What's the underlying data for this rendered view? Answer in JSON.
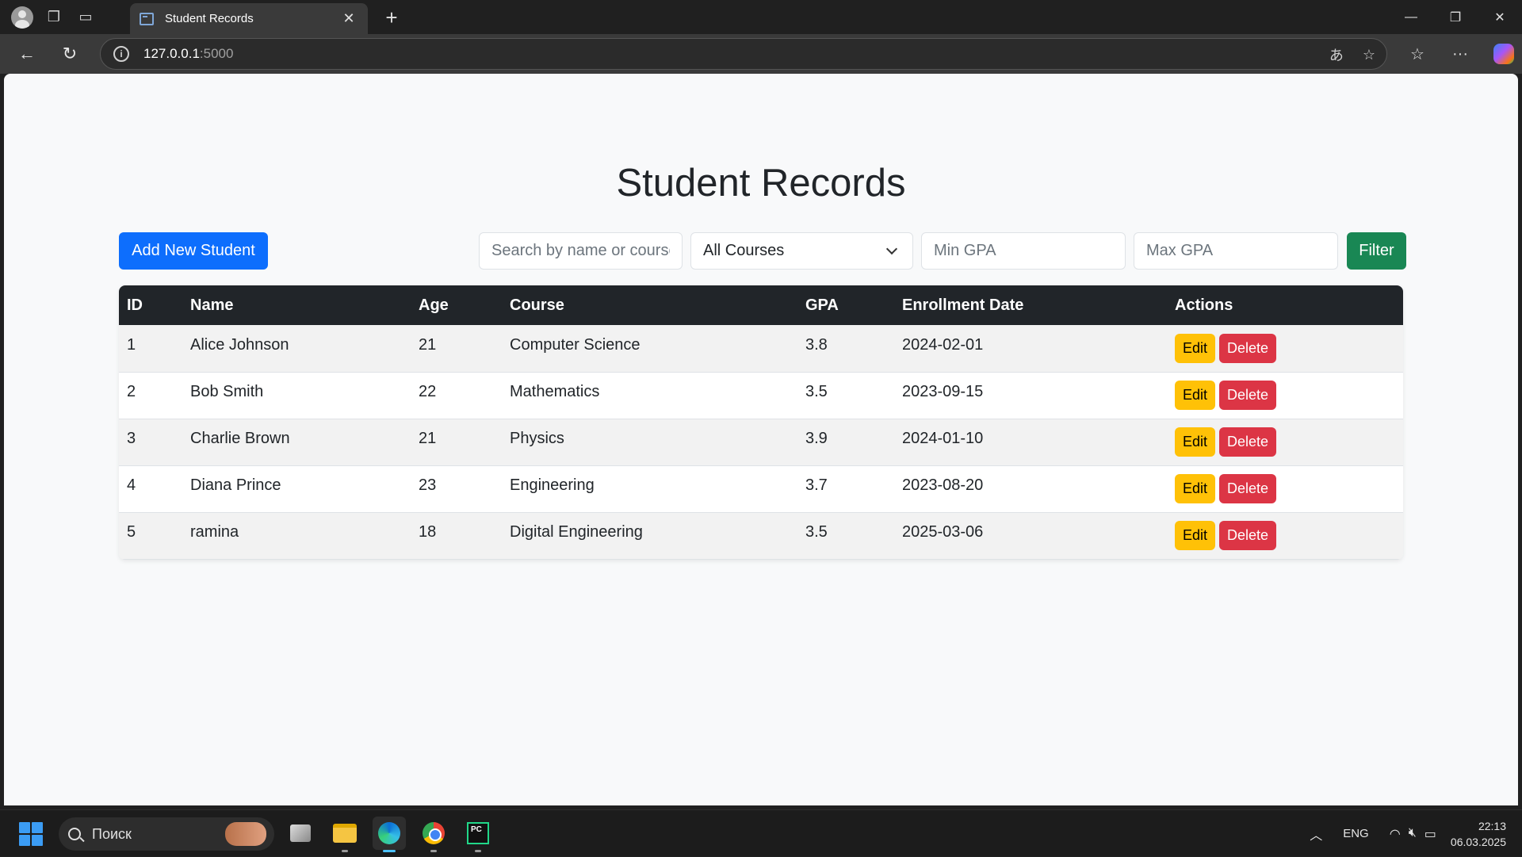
{
  "browser": {
    "tab_title": "Student Records",
    "url_host": "127.0.0.1",
    "url_port": ":5000",
    "close_tab_glyph": "✕",
    "new_tab_glyph": "+"
  },
  "page": {
    "title": "Student Records",
    "add_button": "Add New Student",
    "search_placeholder": "Search by name or course",
    "course_select_value": "All Courses",
    "min_gpa_placeholder": "Min GPA",
    "max_gpa_placeholder": "Max GPA",
    "filter_button": "Filter"
  },
  "table": {
    "headers": [
      "ID",
      "Name",
      "Age",
      "Course",
      "GPA",
      "Enrollment Date",
      "Actions"
    ],
    "edit_label": "Edit",
    "delete_label": "Delete",
    "rows": [
      {
        "id": "1",
        "name": "Alice Johnson",
        "age": "21",
        "course": "Computer Science",
        "gpa": "3.8",
        "date": "2024-02-01"
      },
      {
        "id": "2",
        "name": "Bob Smith",
        "age": "22",
        "course": "Mathematics",
        "gpa": "3.5",
        "date": "2023-09-15"
      },
      {
        "id": "3",
        "name": "Charlie Brown",
        "age": "21",
        "course": "Physics",
        "gpa": "3.9",
        "date": "2024-01-10"
      },
      {
        "id": "4",
        "name": "Diana Prince",
        "age": "23",
        "course": "Engineering",
        "gpa": "3.7",
        "date": "2023-08-20"
      },
      {
        "id": "5",
        "name": "ramina",
        "age": "18",
        "course": "Digital Engineering",
        "gpa": "3.5",
        "date": "2025-03-06"
      }
    ]
  },
  "taskbar": {
    "search_text": "Поиск",
    "language": "ENG",
    "time": "22:13",
    "date": "06.03.2025"
  },
  "colors": {
    "primary": "#0d6efd",
    "success": "#198754",
    "warning": "#ffc107",
    "danger": "#dc3545",
    "table_header": "#212529"
  }
}
